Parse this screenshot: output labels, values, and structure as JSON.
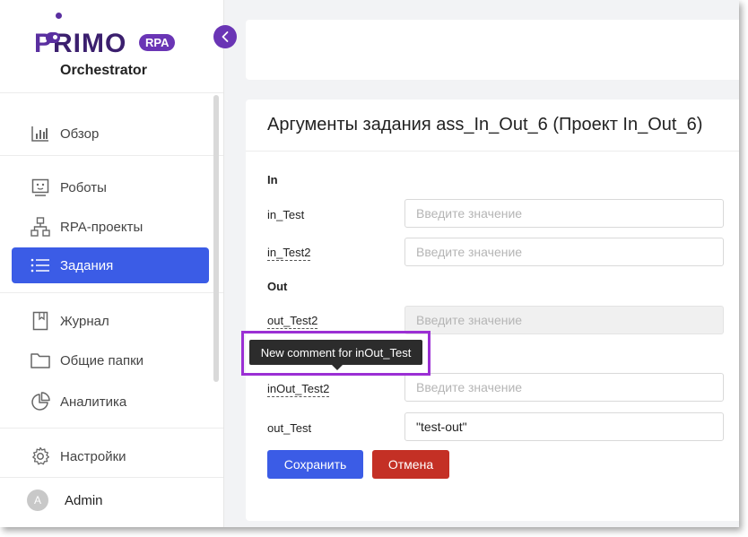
{
  "brand": {
    "name_prefix": "P",
    "name_rest": "RIMO",
    "badge": "RPA",
    "subtitle": "Orchestrator",
    "accent_color": "#6a35b5"
  },
  "sidebar": {
    "items": [
      {
        "label": "Обзор",
        "icon": "bar-chart-icon",
        "active": false
      },
      {
        "label": "Роботы",
        "icon": "robot-icon",
        "active": false
      },
      {
        "label": "RPA-проекты",
        "icon": "sitemap-icon",
        "active": false
      },
      {
        "label": "Задания",
        "icon": "list-icon",
        "active": true
      },
      {
        "label": "Журнал",
        "icon": "book-icon",
        "active": false
      },
      {
        "label": "Общие папки",
        "icon": "folder-icon",
        "active": false
      },
      {
        "label": "Аналитика",
        "icon": "pie-chart-icon",
        "active": false
      },
      {
        "label": "Настройки",
        "icon": "gear-icon",
        "active": false
      }
    ],
    "user": {
      "avatar_letter": "A",
      "name": "Admin"
    },
    "active_color": "#3b5ce6"
  },
  "form": {
    "title": "Аргументы задания ass_In_Out_6 (Проект In_Out_6)",
    "sections": {
      "in": "In",
      "out": "Out"
    },
    "placeholder": "Введите значение",
    "args": {
      "in_test": {
        "label": "in_Test",
        "value": ""
      },
      "in_test2": {
        "label": "in_Test2",
        "value": ""
      },
      "out_test2": {
        "label": "out_Test2",
        "value": ""
      },
      "inout_test2": {
        "label": "inOut_Test2",
        "value": ""
      },
      "out_test": {
        "label": "out_Test",
        "value": "\"test-out\""
      }
    },
    "save_label": "Сохранить",
    "cancel_label": "Отмена"
  },
  "tooltip": {
    "text": "New comment for inOut_Test",
    "highlight_color": "#9b2fd4"
  }
}
